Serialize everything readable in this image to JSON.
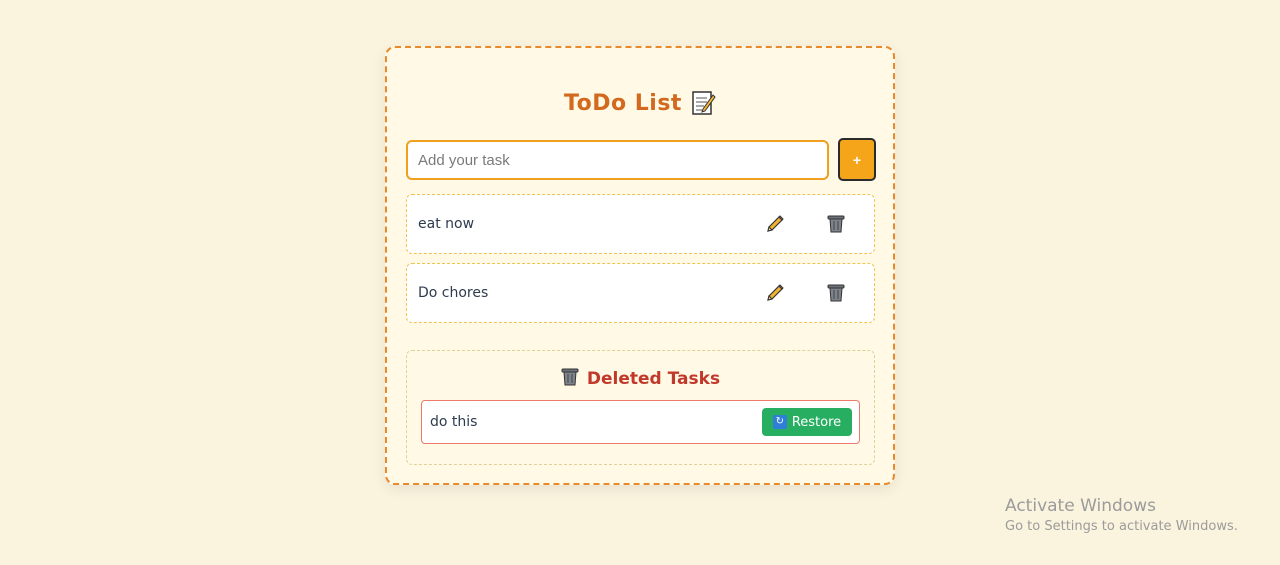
{
  "app": {
    "title": "ToDo List",
    "title_icon": "memo-icon"
  },
  "input": {
    "placeholder": "Add your task",
    "value": "",
    "add_label": "+"
  },
  "tasks": [
    {
      "text": "eat now",
      "edit_icon": "pencil-icon",
      "delete_icon": "trash-icon"
    },
    {
      "text": "Do chores",
      "edit_icon": "pencil-icon",
      "delete_icon": "trash-icon"
    }
  ],
  "deleted": {
    "title": "Deleted Tasks",
    "title_icon": "trash-icon",
    "items": [
      {
        "text": "do this",
        "restore_label": "Restore",
        "restore_icon": "refresh-icon"
      }
    ]
  },
  "watermark": {
    "title": "Activate Windows",
    "subtitle": "Go to Settings to activate Windows."
  },
  "colors": {
    "page_bg": "#faf3de",
    "card_bg": "#fff9e6",
    "accent": "#e8892c",
    "title": "#d2691e",
    "add_button": "#f5a51a",
    "deleted_title": "#c0392b",
    "restore_button": "#27ae60"
  }
}
